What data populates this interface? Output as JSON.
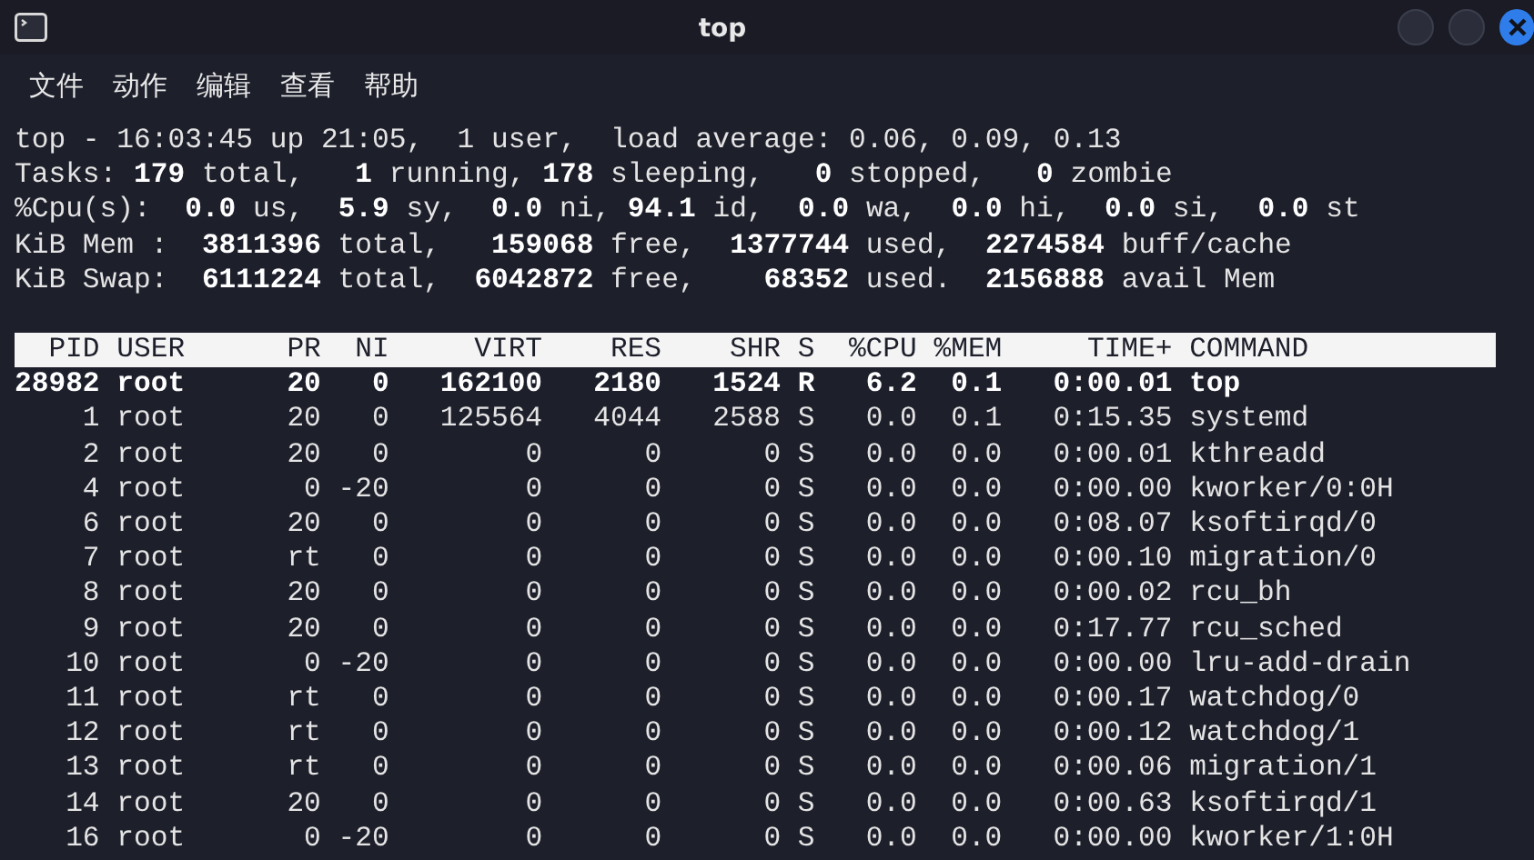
{
  "window": {
    "title": "top"
  },
  "menu": [
    "文件",
    "动作",
    "编辑",
    "查看",
    "帮助"
  ],
  "summary": [
    "top - 16:03:45 up 21:05,  1 user,  load average: 0.06, 0.09, 0.13",
    "Tasks: **179** total,   **1** running, **178** sleeping,   **0** stopped,   **0** zombie",
    "%Cpu(s):  **0.0** us,  **5.9** sy,  **0.0** ni, **94.1** id,  **0.0** wa,  **0.0** hi,  **0.0** si,  **0.0** st",
    "KiB Mem :  **3811396** total,   **159068** free,  **1377744** used,  **2274584** buff/cache",
    "KiB Swap:  **6111224** total,  **6042872** free,    **68352** used.  **2156888** avail Mem"
  ],
  "table": {
    "columns": [
      "PID",
      "USER",
      "PR",
      "NI",
      "VIRT",
      "RES",
      "SHR",
      "S",
      "%CPU",
      "%MEM",
      "TIME+",
      "COMMAND"
    ],
    "rows": [
      {
        "highlighted": true,
        "cells": [
          "28982",
          "root",
          "20",
          "0",
          "162100",
          "2180",
          "1524",
          "R",
          "6.2",
          "0.1",
          "0:00.01",
          "top"
        ]
      },
      {
        "highlighted": false,
        "cells": [
          "1",
          "root",
          "20",
          "0",
          "125564",
          "4044",
          "2588",
          "S",
          "0.0",
          "0.1",
          "0:15.35",
          "systemd"
        ]
      },
      {
        "highlighted": false,
        "cells": [
          "2",
          "root",
          "20",
          "0",
          "0",
          "0",
          "0",
          "S",
          "0.0",
          "0.0",
          "0:00.01",
          "kthreadd"
        ]
      },
      {
        "highlighted": false,
        "cells": [
          "4",
          "root",
          "0",
          "-20",
          "0",
          "0",
          "0",
          "S",
          "0.0",
          "0.0",
          "0:00.00",
          "kworker/0:0H"
        ]
      },
      {
        "highlighted": false,
        "cells": [
          "6",
          "root",
          "20",
          "0",
          "0",
          "0",
          "0",
          "S",
          "0.0",
          "0.0",
          "0:08.07",
          "ksoftirqd/0"
        ]
      },
      {
        "highlighted": false,
        "cells": [
          "7",
          "root",
          "rt",
          "0",
          "0",
          "0",
          "0",
          "S",
          "0.0",
          "0.0",
          "0:00.10",
          "migration/0"
        ]
      },
      {
        "highlighted": false,
        "cells": [
          "8",
          "root",
          "20",
          "0",
          "0",
          "0",
          "0",
          "S",
          "0.0",
          "0.0",
          "0:00.02",
          "rcu_bh"
        ]
      },
      {
        "highlighted": false,
        "cells": [
          "9",
          "root",
          "20",
          "0",
          "0",
          "0",
          "0",
          "S",
          "0.0",
          "0.0",
          "0:17.77",
          "rcu_sched"
        ]
      },
      {
        "highlighted": false,
        "cells": [
          "10",
          "root",
          "0",
          "-20",
          "0",
          "0",
          "0",
          "S",
          "0.0",
          "0.0",
          "0:00.00",
          "lru-add-drain"
        ]
      },
      {
        "highlighted": false,
        "cells": [
          "11",
          "root",
          "rt",
          "0",
          "0",
          "0",
          "0",
          "S",
          "0.0",
          "0.0",
          "0:00.17",
          "watchdog/0"
        ]
      },
      {
        "highlighted": false,
        "cells": [
          "12",
          "root",
          "rt",
          "0",
          "0",
          "0",
          "0",
          "S",
          "0.0",
          "0.0",
          "0:00.12",
          "watchdog/1"
        ]
      },
      {
        "highlighted": false,
        "cells": [
          "13",
          "root",
          "rt",
          "0",
          "0",
          "0",
          "0",
          "S",
          "0.0",
          "0.0",
          "0:00.06",
          "migration/1"
        ]
      },
      {
        "highlighted": false,
        "cells": [
          "14",
          "root",
          "20",
          "0",
          "0",
          "0",
          "0",
          "S",
          "0.0",
          "0.0",
          "0:00.63",
          "ksoftirqd/1"
        ]
      },
      {
        "highlighted": false,
        "cells": [
          "16",
          "root",
          "0",
          "-20",
          "0",
          "0",
          "0",
          "S",
          "0.0",
          "0.0",
          "0:00.00",
          "kworker/1:0H"
        ]
      }
    ]
  }
}
